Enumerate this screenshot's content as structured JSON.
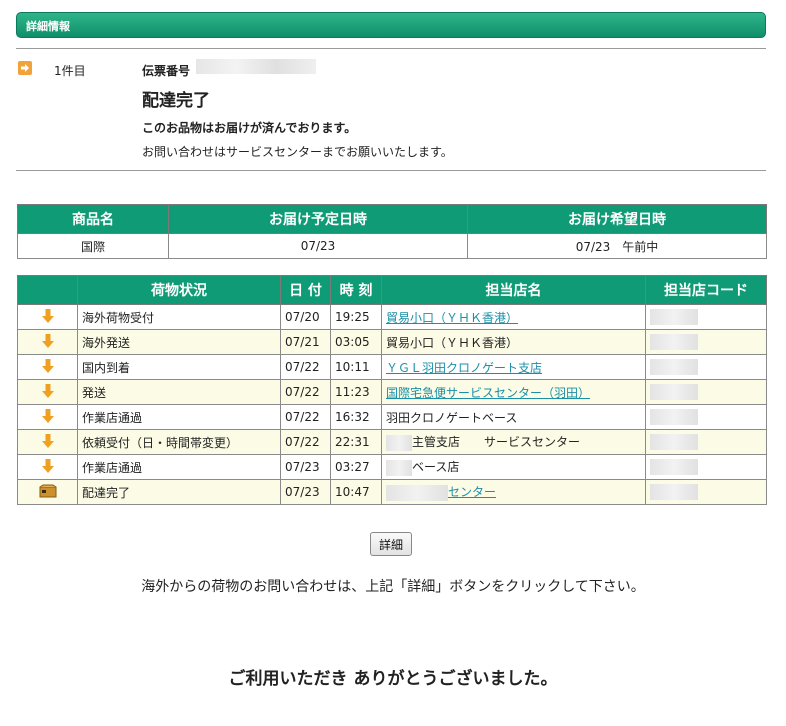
{
  "header": {
    "title": "詳細情報"
  },
  "summary": {
    "count_label": "1件目",
    "tracking_label": "伝票番号",
    "status_title": "配達完了",
    "message_bold": "このお品物はお届けが済んでおります。",
    "message": "お問い合わせはサービスセンターまでお願いいたします。"
  },
  "delivery_table": {
    "headers": [
      "商品名",
      "お届け予定日時",
      "お届け希望日時"
    ],
    "row": [
      "国際",
      "07/23",
      "07/23　午前中"
    ]
  },
  "tracking_table": {
    "headers": [
      "荷物状況",
      "日 付",
      "時 刻",
      "担当店名",
      "担当店コード"
    ],
    "rows": [
      {
        "status": "海外荷物受付",
        "date": "07/20",
        "time": "19:25",
        "store": "貿易小口（ＹＨＫ香港）"
      },
      {
        "status": "海外発送",
        "date": "07/21",
        "time": "03:05",
        "store": "貿易小口（ＹＨＫ香港）"
      },
      {
        "status": "国内到着",
        "date": "07/22",
        "time": "10:11",
        "store": "ＹＧＬ羽田クロノゲート支店"
      },
      {
        "status": "発送",
        "date": "07/22",
        "time": "11:23",
        "store": "国際宅急便サービスセンター（羽田）"
      },
      {
        "status": "作業店通過",
        "date": "07/22",
        "time": "16:32",
        "store": "羽田クロノゲートベース"
      },
      {
        "status": "依頼受付（日・時間帯変更）",
        "date": "07/22",
        "time": "22:31",
        "store": "主管支店　　サービスセンター"
      },
      {
        "status": "作業店通過",
        "date": "07/23",
        "time": "03:27",
        "store": "ベース店"
      },
      {
        "status": "配達完了",
        "date": "07/23",
        "time": "10:47",
        "store": "センター"
      }
    ]
  },
  "detail_button": {
    "label": "詳細"
  },
  "footer": {
    "note": "海外からの荷物のお問い合わせは、上記「詳細」ボタンをクリックして下さい。",
    "thanks": "ご利用いただき ありがとうございました。"
  }
}
